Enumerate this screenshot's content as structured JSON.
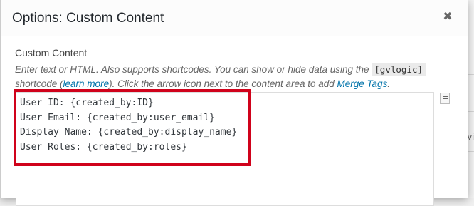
{
  "dialog": {
    "title": "Options: Custom Content",
    "close_icon": "close-icon"
  },
  "field": {
    "label": "Custom Content",
    "description": {
      "part1": "Enter text or HTML. Also supports shortcodes. You can show or hide data using the ",
      "code": "[gvlogic]",
      "part2": " shortcode (",
      "learn_more": "learn more",
      "part3": "). Click the arrow icon next to the content area to add ",
      "merge_tags": "Merge Tags",
      "part4": "."
    },
    "content_lines": [
      "User ID: {created_by:ID}",
      "User Email: {created_by:user_email}",
      "Display Name: {created_by:display_name}",
      "User Roles: {created_by:roles}"
    ],
    "merge_tags_icon": "merge-tags-icon"
  },
  "background": {
    "partial_text": "vi"
  },
  "colors": {
    "highlight": "#d0021b",
    "link": "#0073aa"
  }
}
